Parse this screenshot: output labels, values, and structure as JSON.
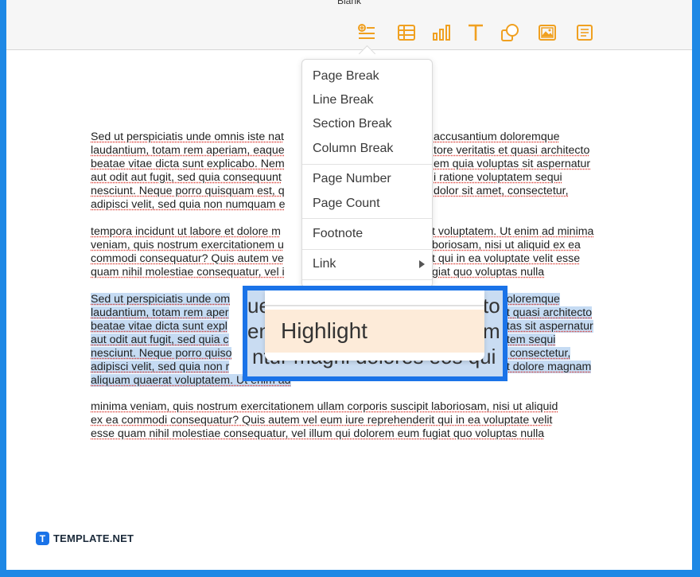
{
  "document": {
    "title": "Blank"
  },
  "toolbar": {
    "accent_color": "#f0a020",
    "tools": [
      {
        "name": "insert",
        "icon": "insert-list-icon",
        "active": true
      },
      {
        "name": "table",
        "icon": "table-icon"
      },
      {
        "name": "chart",
        "icon": "chart-icon"
      },
      {
        "name": "text",
        "icon": "text-icon"
      },
      {
        "name": "shape",
        "icon": "shape-icon"
      },
      {
        "name": "media",
        "icon": "media-icon"
      },
      {
        "name": "comment",
        "icon": "comment-icon"
      }
    ]
  },
  "insert_menu": {
    "items": [
      "Page Break",
      "Line Break",
      "Section Break",
      "Column Break",
      "Page Number",
      "Page Count",
      "Footnote",
      "Link"
    ]
  },
  "body": {
    "p1": [
      "Sed ut perspiciatis unde omnis iste nat",
      "laudantium, totam rem aperiam, eaque",
      "beatae vitae dicta sunt explicabo. Nem",
      "aut odit aut fugit, sed quia consequunt",
      "nesciunt. Neque porro quisquam est, q",
      "adipisci velit, sed quia non numquam e"
    ],
    "p1_right": [
      "accusantium doloremque",
      "tore veritatis et quasi architecto",
      "em quia voluptas sit aspernatur",
      "i ratione voluptatem sequi",
      "dolor sit amet, consectetur,",
      ""
    ],
    "p2_left": [
      " tempora incidunt ut labore et dolore m",
      "veniam, quis nostrum exercitationem u",
      "commodi consequatur? Quis autem ve",
      "quam nihil molestiae consequatur, vel i"
    ],
    "p2_right": [
      "t voluptatem. Ut enim ad minima",
      "boriosam, nisi ut aliquid ex ea",
      "t qui in ea voluptate velit esse",
      "giat quo voluptas nulla"
    ],
    "p3_left": [
      "Sed ut perspiciatis unde om",
      "laudantium, totam rem aper",
      "beatae vitae dicta sunt expl",
      "aut odit aut fugit, sed quia c",
      "nesciunt. Neque porro quiso",
      "adipisci velit, sed quia non r",
      "aliquam quaerat voluptatem. Ut enim ad"
    ],
    "p3_right": [
      " doloremque",
      "et quasi architecto",
      "ptas sit aspernatur",
      "atem sequi",
      "t, consectetur,",
      " et dolore magnam",
      ""
    ],
    "p4": [
      "minima veniam, quis nostrum exercitationem ullam corporis suscipit laboriosam, nisi ut aliquid",
      "ex ea commodi consequatur? Quis autem vel eum iure reprehenderit qui in ea voluptate velit",
      "esse quam nihil molestiae consequatur, vel illum qui dolorem eum fugiat quo voluptas nulla"
    ]
  },
  "zoom_callout": {
    "bg_text": [
      "ue",
      "em",
      "ntur magni dolores eos qui"
    ],
    "right_bg_text": [
      "to",
      "m"
    ],
    "highlight_label": "Highlight"
  },
  "brand": {
    "logo_letter": "T",
    "name": "TEMPLATE.NET"
  }
}
